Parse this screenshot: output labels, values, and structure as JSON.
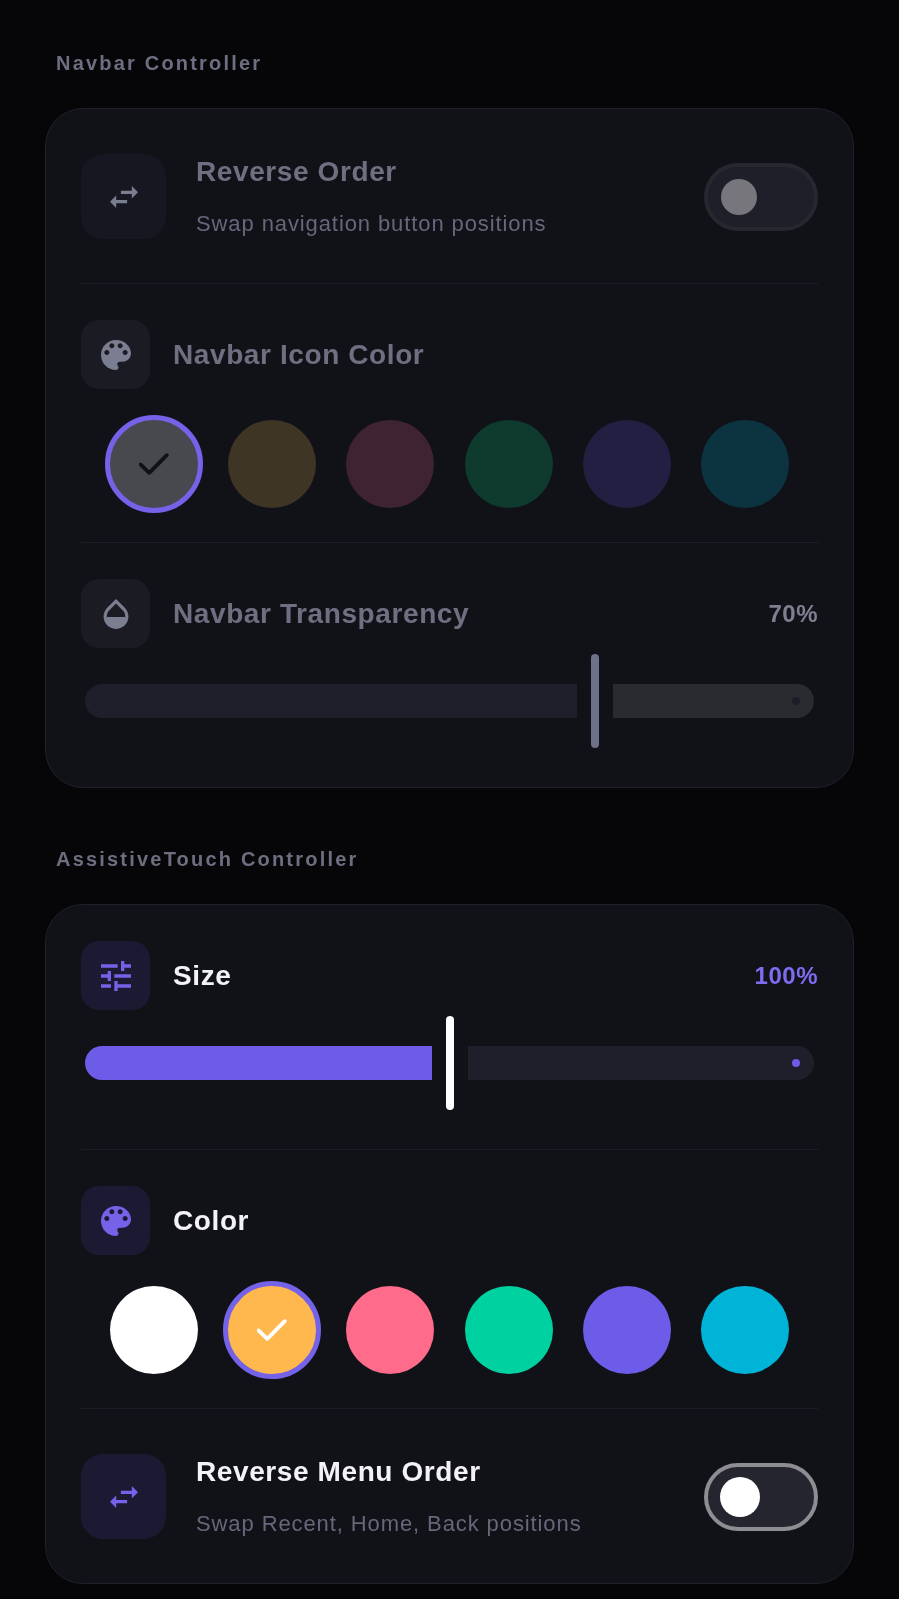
{
  "sections": [
    {
      "title": "Navbar Controller",
      "disabled": true,
      "rows": [
        {
          "kind": "toggle",
          "title": "Reverse Order",
          "subtitle": "Swap navigation button positions",
          "on": false
        },
        {
          "kind": "colors",
          "title": "Navbar Icon Color",
          "swatches": [
            {
              "color": "#48484f",
              "selected": true
            },
            {
              "color": "#3f3524",
              "selected": false
            },
            {
              "color": "#402330",
              "selected": false
            },
            {
              "color": "#0f3a2e",
              "selected": false
            },
            {
              "color": "#221f42",
              "selected": false
            },
            {
              "color": "#0c3440",
              "selected": false
            }
          ]
        },
        {
          "kind": "slider",
          "title": "Navbar Transparency",
          "reading": "70%",
          "level": 0.7
        }
      ]
    },
    {
      "title": "AssistiveTouch Controller",
      "disabled": false,
      "rows": [
        {
          "kind": "slider",
          "title": "Size",
          "reading": "100%",
          "level": 0.5
        },
        {
          "kind": "colors",
          "title": "Color",
          "swatches": [
            {
              "color": "#ffffff",
              "selected": false
            },
            {
              "color": "#ffb84d",
              "selected": true
            },
            {
              "color": "#ff6b8a",
              "selected": false
            },
            {
              "color": "#00d1a0",
              "selected": false
            },
            {
              "color": "#6c5ce7",
              "selected": false
            },
            {
              "color": "#00b4d8",
              "selected": false
            }
          ]
        },
        {
          "kind": "toggle",
          "title": "Reverse Menu Order",
          "subtitle": "Swap Recent, Home, Back positions",
          "on": false
        }
      ]
    }
  ]
}
